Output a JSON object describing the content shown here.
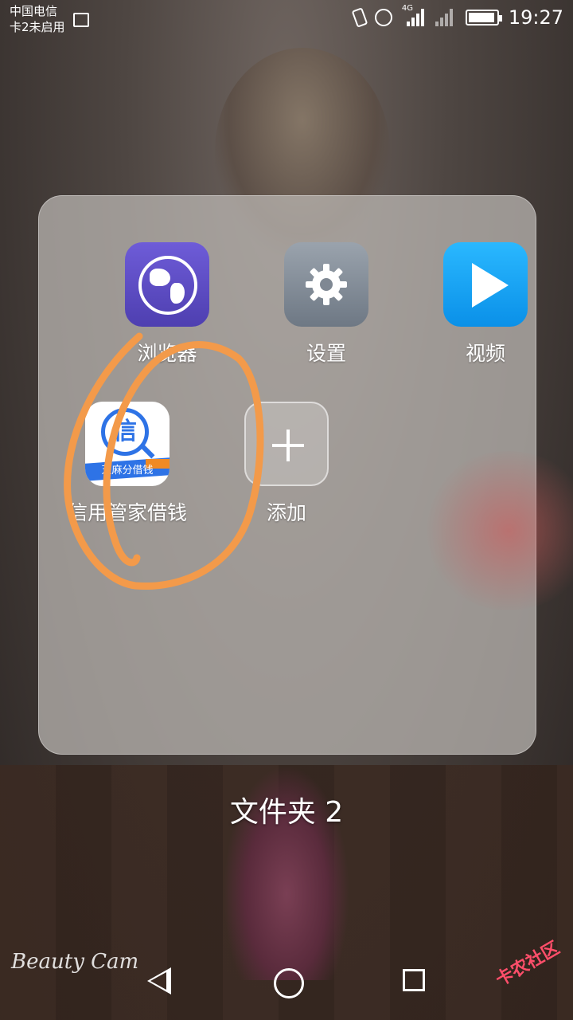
{
  "status_bar": {
    "carrier_line1": "中国电信",
    "carrier_line2": "卡2未启用",
    "network_type": "4G",
    "time": "19:27",
    "battery_level": 0.95,
    "icons": [
      "screenshot-icon",
      "vibrate-icon",
      "alarm-icon",
      "signal-icon",
      "signal-icon-sim2",
      "battery-icon"
    ]
  },
  "folder": {
    "title": "文件夹 2",
    "apps": [
      {
        "label": "浏览器",
        "icon": "browser-globe-icon",
        "color": "#5b49c8"
      },
      {
        "label": "设置",
        "icon": "gear-icon",
        "color": "#7f8893"
      },
      {
        "label": "视频",
        "icon": "play-icon",
        "color": "#18a6f5"
      },
      {
        "label": "信用管家借钱",
        "icon": "xin-app-icon",
        "color": "#2e73e6",
        "icon_badge": "芝麻分借钱"
      },
      {
        "label": "添加",
        "icon": "plus-icon"
      }
    ]
  },
  "annotation": {
    "color": "#f39a4a"
  },
  "nav_bar": {
    "icons": [
      "back-icon",
      "home-icon",
      "recents-icon"
    ]
  },
  "watermarks": {
    "left": "Beauty Cam",
    "right": "卡农社区"
  }
}
